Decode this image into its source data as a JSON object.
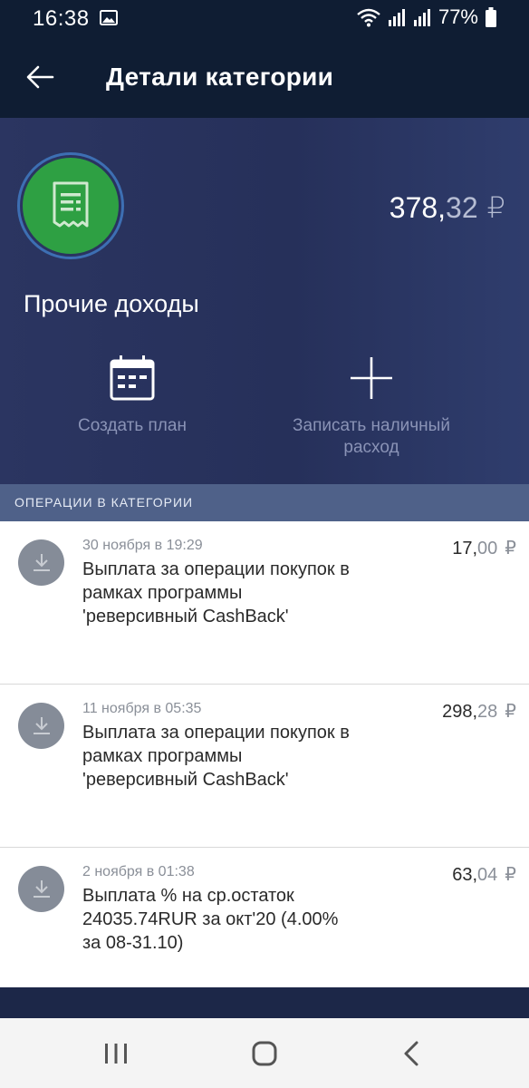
{
  "status_bar": {
    "time": "16:38",
    "battery": "77%",
    "icons": [
      "image-icon",
      "wifi-icon",
      "signal-icon",
      "signal-icon",
      "battery-icon"
    ]
  },
  "app_bar": {
    "title": "Детали категории",
    "back_icon": "arrow-left-icon"
  },
  "category": {
    "icon": "receipt-icon",
    "icon_color": "#2ea043",
    "name": "Прочие доходы",
    "amount_int": "378,",
    "amount_frac": "32",
    "currency": "₽"
  },
  "actions": {
    "create_plan": "Создать план",
    "record_cash": "Записать наличный расход"
  },
  "section_title": "ОПЕРАЦИИ В КАТЕГОРИИ",
  "operations": [
    {
      "date": "30 ноября в 19:29",
      "description": "Выплата за операции покупок в рамках программы 'реверсивный CashBack'",
      "amount_int": "17,",
      "amount_frac": "00",
      "currency": "₽"
    },
    {
      "date": "11 ноября в 05:35",
      "description": "Выплата за операции покупок в рамках программы 'реверсивный CashBack'",
      "amount_int": "298,",
      "amount_frac": "28",
      "currency": "₽"
    },
    {
      "date": "2 ноября в 01:38",
      "description": "Выплата % на ср.остаток 24035.74RUR за окт'20 (4.00% за 08-31.10)",
      "amount_int": "63,",
      "amount_frac": "04",
      "currency": "₽"
    }
  ],
  "colors": {
    "header_bg": "#0f1d33",
    "section_header_bg": "#4f6189",
    "income_avatar": "#858c98"
  }
}
